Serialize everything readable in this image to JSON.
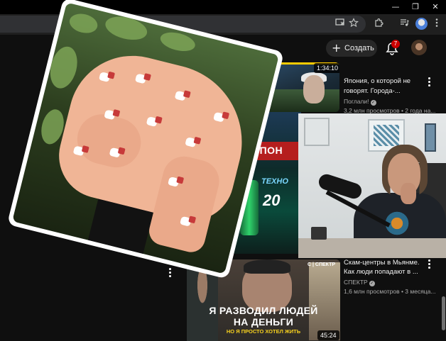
{
  "browser": {
    "window_controls": {
      "minimize": "—",
      "maximize": "❐",
      "close": "✕"
    },
    "toolbar_icons": [
      "install-app-icon",
      "star-icon",
      "extensions-icon",
      "media-controls-icon",
      "profile-icon",
      "kebab-menu-icon"
    ]
  },
  "header": {
    "create_label": "Создать",
    "notifications_count": "7"
  },
  "videos": [
    {
      "duration": "1:34:10",
      "title_line1": "Япония, о которой не",
      "title_line2": "говорят. Города-...",
      "channel": "Поглали!",
      "stats": "3,2 млн просмотров • 2 года на..."
    },
    {
      "title_line1": "Скам-центры в Мьянме.",
      "title_line2": "Как люди попадают в ...",
      "channel": "СПЕКТР",
      "stats": "1,6 млн просмотров • 3 месяца...",
      "thumb_line1": "Я РАЗВОДИЛ ЛЮДЕЙ",
      "thumb_line2": "НА ДЕНЬГИ",
      "thumb_line3": "НО Я ПРОСТО ХОТЕЛ ЖИТЬ",
      "thumb_label": "С | СПЕКТР",
      "duration": "45:24"
    }
  ],
  "middle_thumb": {
    "banner": "А ЯПОН",
    "tech": "ТЕХНО",
    "year": "20"
  },
  "colors": {
    "background": "#0f0f0f",
    "badge": "#cc0000",
    "thumb_red_banner": "#b51e1e"
  }
}
